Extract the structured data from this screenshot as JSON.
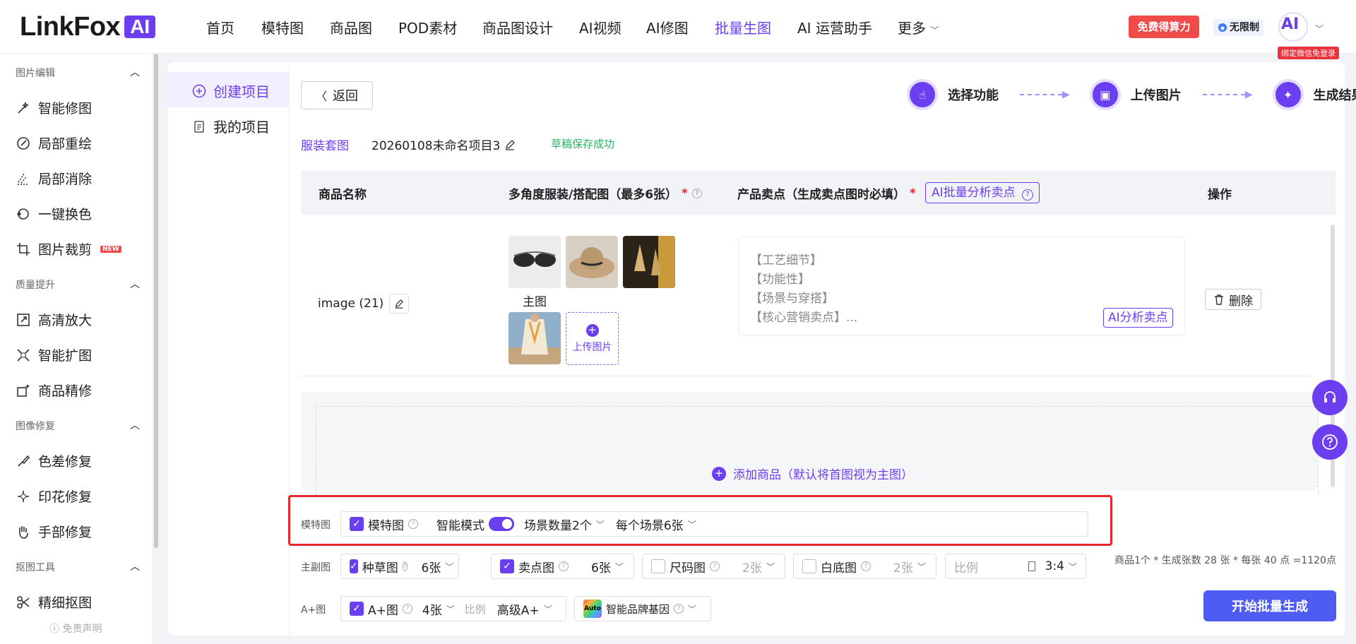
{
  "header": {
    "logo_text": "LinkFox",
    "logo_badge": "AI",
    "nav": [
      "首页",
      "模特图",
      "商品图",
      "POD素材",
      "商品图设计",
      "AI视频",
      "AI修图",
      "批量生图",
      "AI 运营助手",
      "更多"
    ],
    "active_nav": "批量生图",
    "free_btn": "免费得算力",
    "unlimited": "无限制",
    "avatar_text": "AI",
    "bind_tip": "绑定微信免登录"
  },
  "sidebar": {
    "sections": [
      {
        "title": "图片编辑",
        "items": [
          "智能修图",
          "局部重绘",
          "局部消除",
          "一键换色",
          "图片裁剪"
        ]
      },
      {
        "title": "质量提升",
        "items": [
          "高清放大",
          "智能扩图",
          "商品精修"
        ]
      },
      {
        "title": "图像修复",
        "items": [
          "色差修复",
          "印花修复",
          "手部修复"
        ]
      },
      {
        "title": "抠图工具",
        "items": [
          "精细抠图"
        ]
      }
    ],
    "new_tag": "NEW",
    "disclaimer": "免责声明"
  },
  "subnav": {
    "create": "创建项目",
    "mine": "我的项目"
  },
  "toolbar": {
    "back": "返回"
  },
  "steps": [
    "选择功能",
    "上传图片",
    "生成结果"
  ],
  "breadcrumb": {
    "category": "服装套图",
    "project": "20260108未命名项目3",
    "save_status": "草稿保存成功"
  },
  "table": {
    "headers": {
      "name": "商品名称",
      "images": "多角度服装/搭配图（最多6张）",
      "selling": "产品卖点（生成卖点图时必填）",
      "action": "操作"
    },
    "ai_batch_btn": "AI批量分析卖点",
    "row": {
      "name": "image (21)",
      "main_label": "主图",
      "upload_label": "上传图片",
      "selling_points": [
        "【工艺细节】",
        "【功能性】",
        "【场景与穿搭】",
        "【核心营销卖点】..."
      ],
      "ai_sell_btn": "AI分析卖点",
      "delete_btn": "删除"
    },
    "add_product": "添加商品（默认将首图视为主图）"
  },
  "settings": {
    "model_row": {
      "label": "模特图",
      "option": "模特图",
      "smart_mode": "智能模式",
      "scene_count": "场景数量2个",
      "per_scene": "每个场景6张"
    },
    "main_row": {
      "label": "主副图",
      "grass": "种草图",
      "grass_count": "6张",
      "sell": "卖点图",
      "sell_count": "6张",
      "size": "尺码图",
      "size_count": "2张",
      "white": "白底图",
      "white_count": "2张",
      "ratio_label": "比例",
      "ratio": "3:4"
    },
    "aplus_row": {
      "label": "A+图",
      "option": "A+图",
      "count": "4张",
      "ratio_label": "比例",
      "level": "高级A+",
      "auto": "Auto",
      "brand": "智能品牌基因"
    },
    "summary": "商品1个 * 生成张数 28 张 * 每张 40 点 =1120点",
    "start_btn": "开始批量生成"
  },
  "colors": {
    "accent": "#6b3ff0",
    "danger": "#e5282d",
    "success": "#2db36b",
    "primary_btn": "#4e5cf2"
  }
}
